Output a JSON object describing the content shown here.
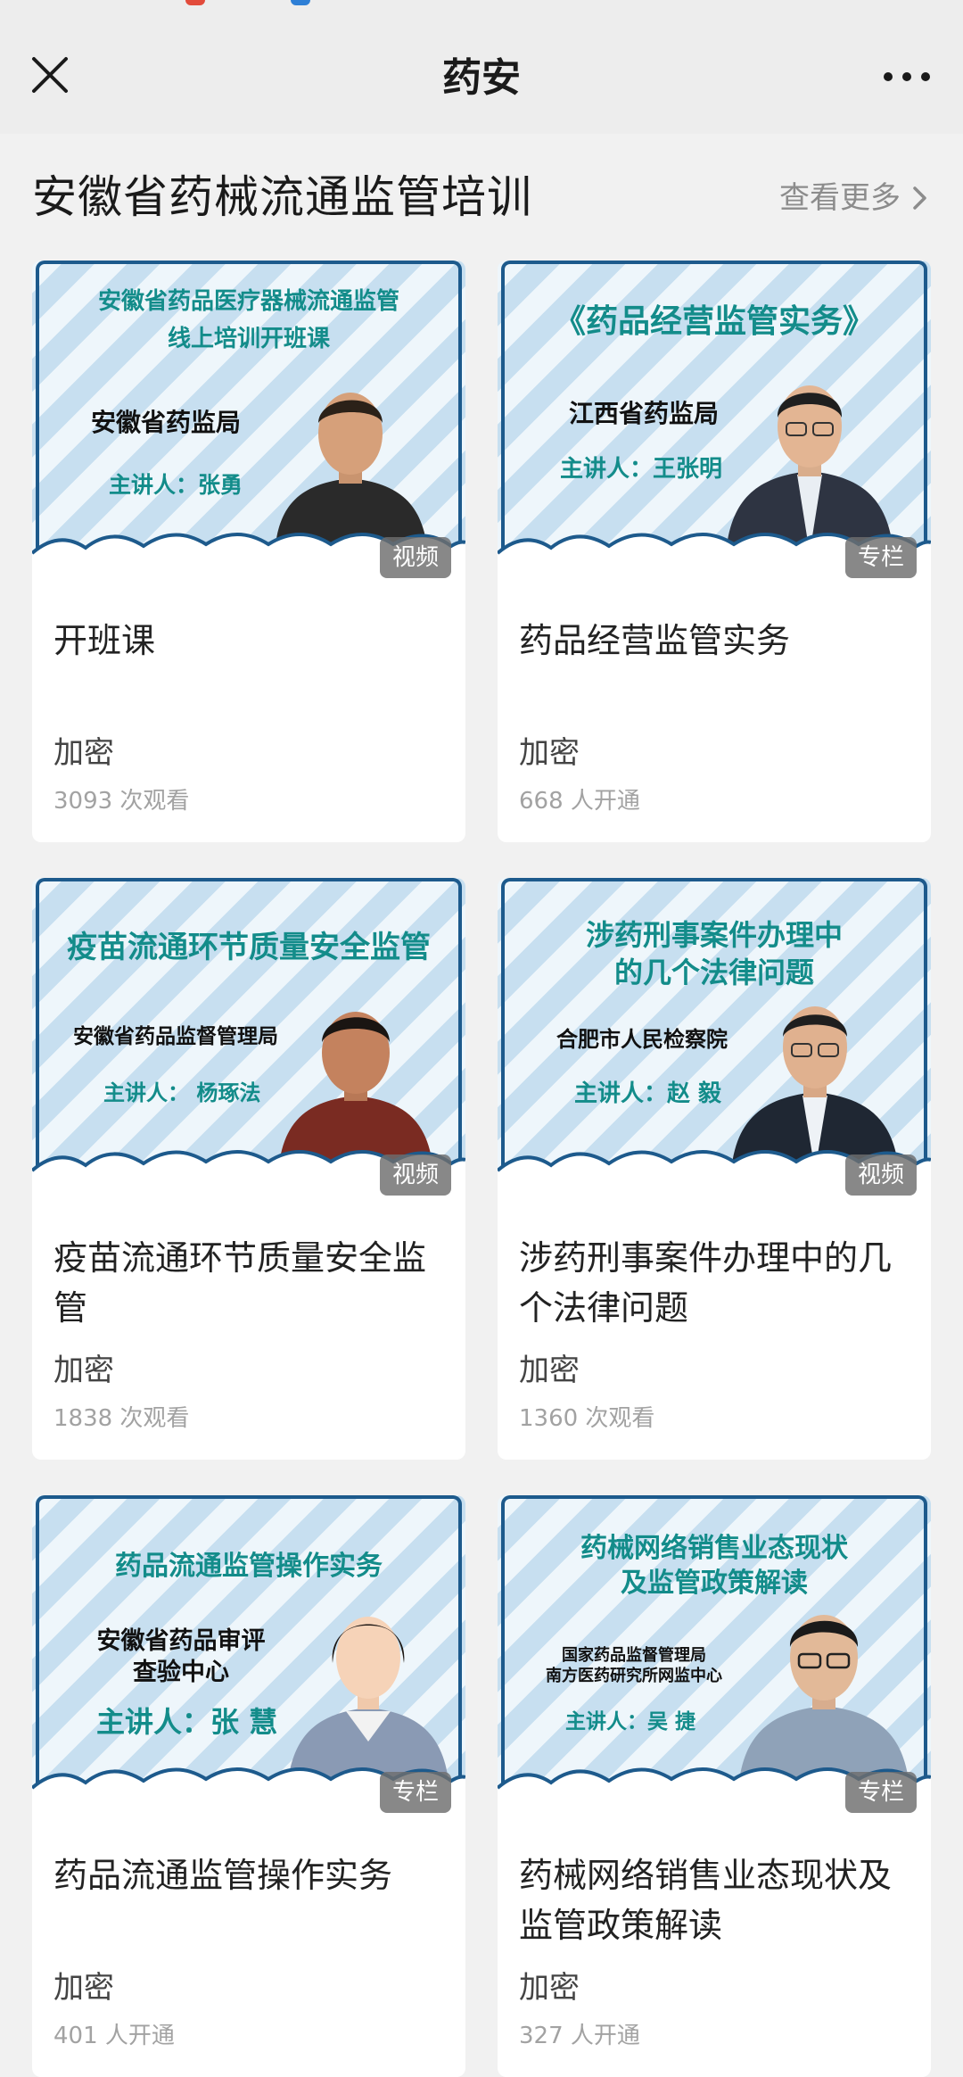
{
  "nav": {
    "title": "药安",
    "close_icon": "close-icon",
    "more_icon": "more-icon"
  },
  "section": {
    "title": "安徽省药械流通监管培训",
    "see_more": "查看更多",
    "see_more_icon": "chevron-right-icon"
  },
  "colors": {
    "accent_teal": "#138c8a",
    "frame_blue": "#1d5a8c",
    "badge_bg": "#6e6e6e"
  },
  "cards": [
    {
      "thumb": {
        "headline_lines": [
          "安徽省药品医疗器械流通监管",
          "线上培训开班课"
        ],
        "org_lines": [
          "安徽省药监局"
        ],
        "speaker": "主讲人：张勇",
        "badge": "视频"
      },
      "title": "开班课",
      "lock": "加密",
      "stat": "3093 次观看"
    },
    {
      "thumb": {
        "headline_lines": [
          "《药品经营监管实务》"
        ],
        "org_lines": [
          "江西省药监局"
        ],
        "speaker": "主讲人：王张明",
        "badge": "专栏"
      },
      "title": "药品经营监管实务",
      "lock": "加密",
      "stat": "668 人开通"
    },
    {
      "thumb": {
        "headline_lines": [
          "疫苗流通环节质量安全监管"
        ],
        "org_lines": [
          "安徽省药品监督管理局"
        ],
        "speaker": "主讲人： 杨琢法",
        "badge": "视频"
      },
      "title": "疫苗流通环节质量安全监管",
      "lock": "加密",
      "stat": "1838 次观看"
    },
    {
      "thumb": {
        "headline_lines": [
          "涉药刑事案件办理中",
          "的几个法律问题"
        ],
        "org_lines": [
          "合肥市人民检察院"
        ],
        "speaker": "主讲人：赵 毅",
        "badge": "视频"
      },
      "title": "涉药刑事案件办理中的几个法律问题",
      "lock": "加密",
      "stat": "1360 次观看"
    },
    {
      "thumb": {
        "headline_lines": [
          "药品流通监管操作实务"
        ],
        "org_lines": [
          "安徽省药品审评",
          "查验中心"
        ],
        "speaker": "主讲人：张 慧",
        "badge": "专栏"
      },
      "title": "药品流通监管操作实务",
      "lock": "加密",
      "stat": "401 人开通"
    },
    {
      "thumb": {
        "headline_lines": [
          "药械网络销售业态现状",
          "及监管政策解读"
        ],
        "org_lines": [
          "国家药品监督管理局",
          "南方医药研究所网监中心"
        ],
        "speaker": "主讲人：吴 捷",
        "badge": "专栏"
      },
      "title": "药械网络销售业态现状及监管政策解读",
      "lock": "加密",
      "stat": "327 人开通"
    }
  ]
}
